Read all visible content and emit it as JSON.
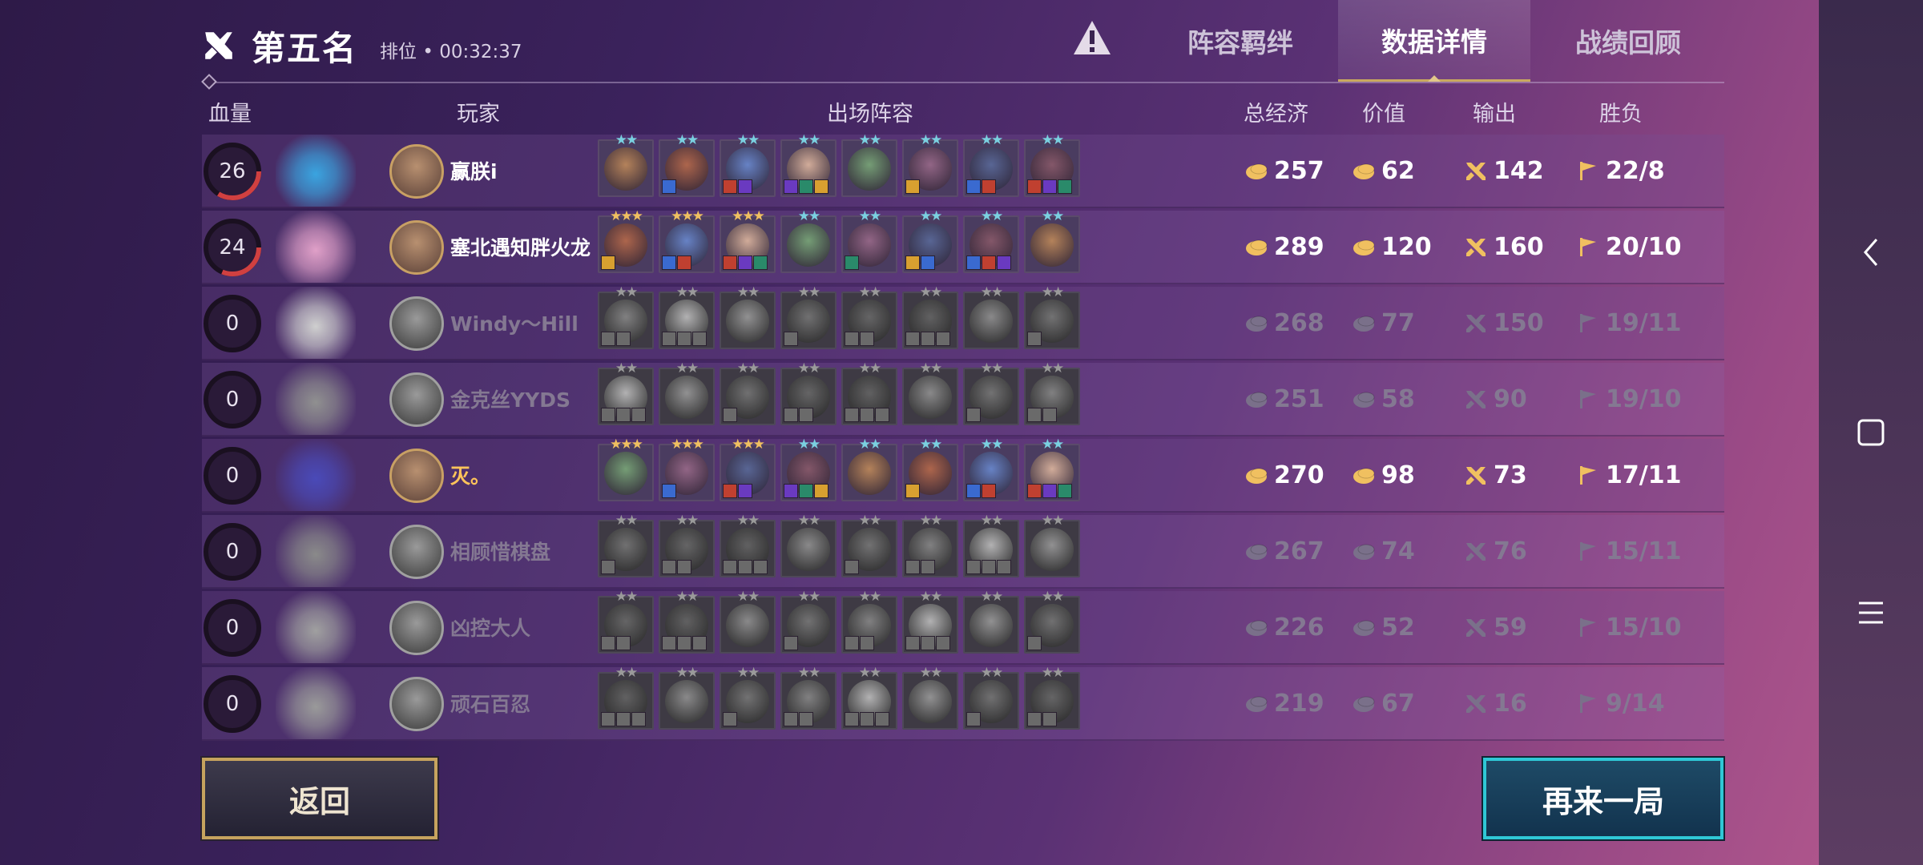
{
  "header": {
    "title": "第五名",
    "mode": "排位 • 00:32:37"
  },
  "tabs": [
    {
      "label": "阵容羁绊",
      "active": false
    },
    {
      "label": "数据详情",
      "active": true
    },
    {
      "label": "战绩回顾",
      "active": false
    }
  ],
  "columns": {
    "hp": "血量",
    "player": "玩家",
    "lineup": "出场阵容",
    "economy": "总经济",
    "value": "价值",
    "damage": "输出",
    "record": "胜负"
  },
  "players": [
    {
      "hp": "26",
      "hp_fraction": 0.26,
      "name": "赢朕i",
      "economy": "257",
      "value": "62",
      "damage": "142",
      "record": "22/8",
      "alive": true,
      "self": false,
      "little_color": "#3aa4e0",
      "unit_stars": [
        2,
        2,
        2,
        2,
        2,
        2,
        2,
        2
      ]
    },
    {
      "hp": "24",
      "hp_fraction": 0.24,
      "name": "塞北遇知胖火龙",
      "economy": "289",
      "value": "120",
      "damage": "160",
      "record": "20/10",
      "alive": true,
      "self": false,
      "little_color": "#e0a0c8",
      "unit_stars": [
        3,
        3,
        3,
        2,
        2,
        2,
        2,
        2
      ]
    },
    {
      "hp": "0",
      "hp_fraction": 0,
      "name": "Windy～Hill",
      "economy": "268",
      "value": "77",
      "damage": "150",
      "record": "19/11",
      "alive": false,
      "self": false,
      "little_color": "#cfcfcf",
      "unit_stars": [
        2,
        2,
        2,
        2,
        2,
        2,
        2,
        2
      ]
    },
    {
      "hp": "0",
      "hp_fraction": 0,
      "name": "金克丝YYDS",
      "economy": "251",
      "value": "58",
      "damage": "90",
      "record": "19/10",
      "alive": false,
      "self": false,
      "little_color": "#909090",
      "unit_stars": [
        2,
        2,
        2,
        2,
        2,
        2,
        2,
        2
      ]
    },
    {
      "hp": "0",
      "hp_fraction": 0,
      "name": "灭。",
      "economy": "270",
      "value": "98",
      "damage": "73",
      "record": "17/11",
      "alive": true,
      "self": true,
      "little_color": "#4a4ab8",
      "unit_stars": [
        3,
        3,
        3,
        2,
        2,
        2,
        2,
        2
      ]
    },
    {
      "hp": "0",
      "hp_fraction": 0,
      "name": "相顾惜棋盘",
      "economy": "267",
      "value": "74",
      "damage": "76",
      "record": "15/11",
      "alive": false,
      "self": false,
      "little_color": "#8a8a8a",
      "unit_stars": [
        2,
        2,
        2,
        2,
        2,
        2,
        2,
        2
      ]
    },
    {
      "hp": "0",
      "hp_fraction": 0,
      "name": "凶控大人",
      "economy": "226",
      "value": "52",
      "damage": "59",
      "record": "15/10",
      "alive": false,
      "self": false,
      "little_color": "#a0a0a0",
      "unit_stars": [
        2,
        2,
        2,
        2,
        2,
        2,
        2,
        2
      ]
    },
    {
      "hp": "0",
      "hp_fraction": 0,
      "name": "顽石百忍",
      "economy": "219",
      "value": "67",
      "damage": "16",
      "record": "9/14",
      "alive": false,
      "self": false,
      "little_color": "#9a9a9a",
      "unit_stars": [
        2,
        2,
        2,
        2,
        2,
        2,
        2,
        2
      ]
    }
  ],
  "buttons": {
    "back": "返回",
    "again": "再来一局"
  },
  "colors": {
    "gold": "#f0c060",
    "hp_ring": "#d04040",
    "tab_accent": "#c9a95f",
    "again_border": "#2fc8d6"
  },
  "icons": {
    "rank": "crossed-swords-icon",
    "warning": "warning-icon",
    "economy": "coin-icon",
    "damage": "crossed-swords-icon",
    "record": "flag-icon"
  }
}
